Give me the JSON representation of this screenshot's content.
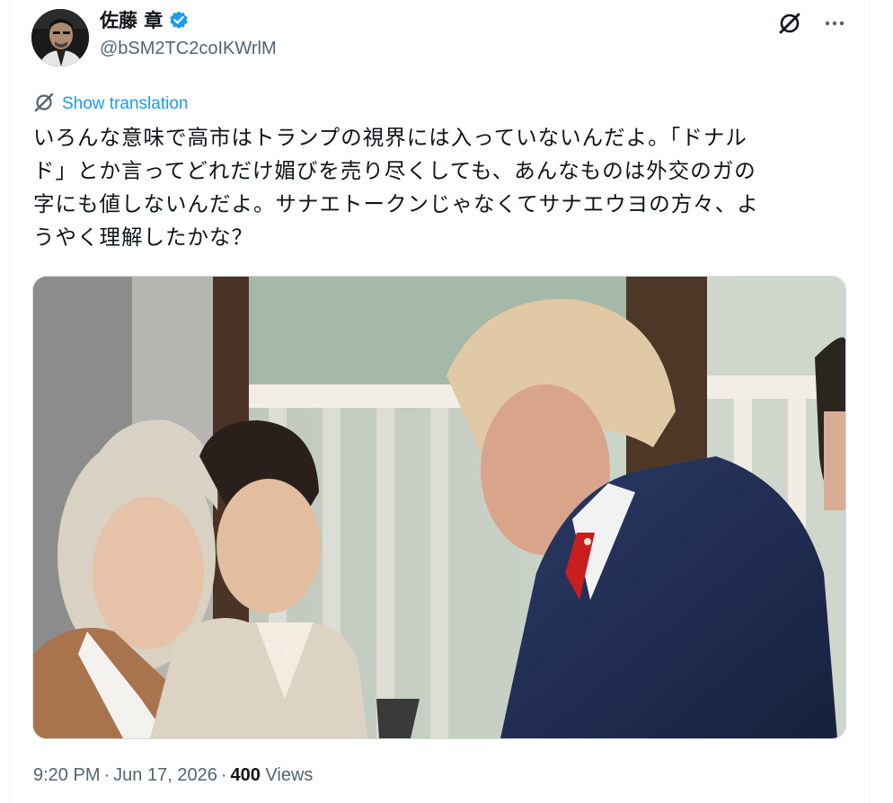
{
  "author": {
    "display_name": "佐藤 章",
    "handle": "@bSM2TC2coIKWrlM",
    "verified": true
  },
  "header_actions": {
    "grok_icon": "grok-icon",
    "more_icon": "more-icon"
  },
  "translation": {
    "label": "Show translation"
  },
  "tweet": {
    "text": "いろんな意味で高市はトランプの視界には入っていないんだよ。「ドナル\nド」とか言ってどれだけ媚びを売り尽くしても、あんなものは外交のガの\n字にも値しないんだよ。サナエトークンじゃなくてサナエウヨの方々、よ\nうやく理解したかな？"
  },
  "meta": {
    "time": "9:20 PM",
    "date": "Jun 17, 2026",
    "views_count": "400",
    "views_label": "Views"
  },
  "colors": {
    "accent": "#1d9bf0",
    "secondary_text": "#536471",
    "primary_text": "#0f1419",
    "border": "#cfd9de"
  }
}
